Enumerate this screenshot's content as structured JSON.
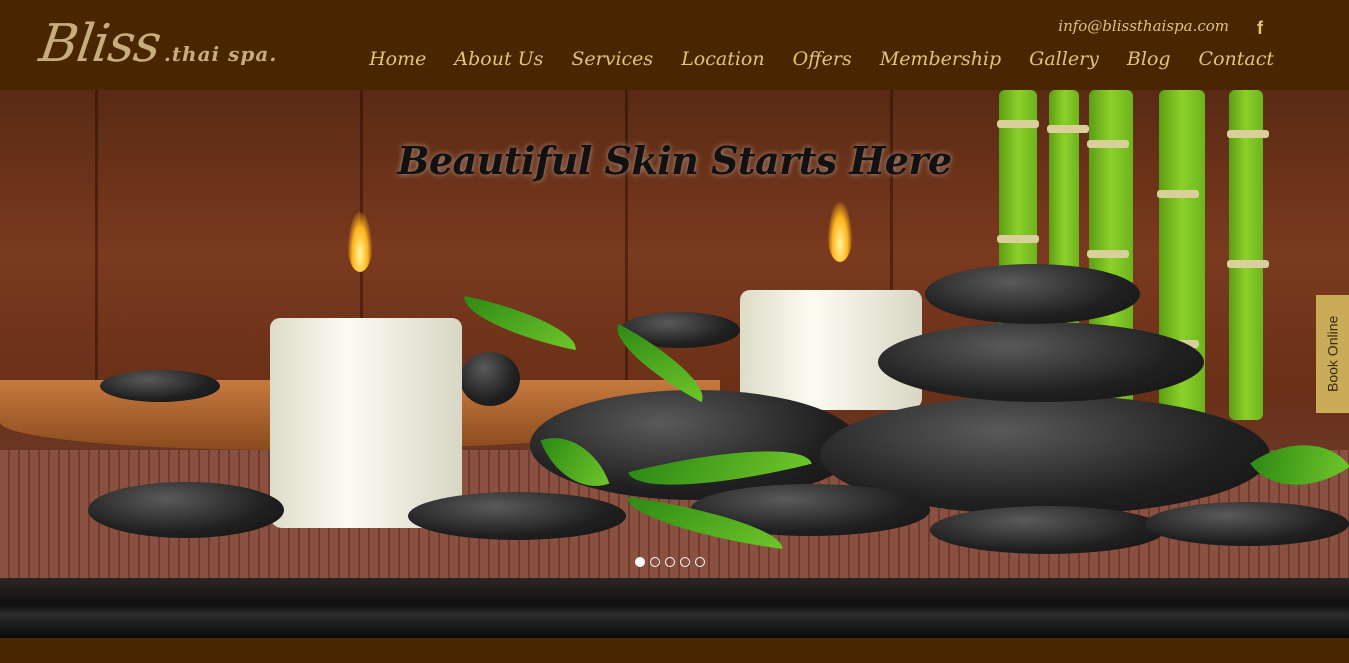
{
  "header": {
    "logo": {
      "main": "Bliss",
      "sub": ".thai spa."
    },
    "email": "info@blissthaispa.com",
    "social_icon": "facebook-icon",
    "nav": [
      "Home",
      "About Us",
      "Services",
      "Location",
      "Offers",
      "Membership",
      "Gallery",
      "Blog",
      "Contact"
    ]
  },
  "hero": {
    "title": "Beautiful Skin Starts Here",
    "slide_count": 5,
    "active_slide": 1
  },
  "book_online": "Book Online",
  "colors": {
    "header_bg": "#4a2600",
    "nav_text": "#e2c374",
    "book_tab": "#c9ab58"
  }
}
